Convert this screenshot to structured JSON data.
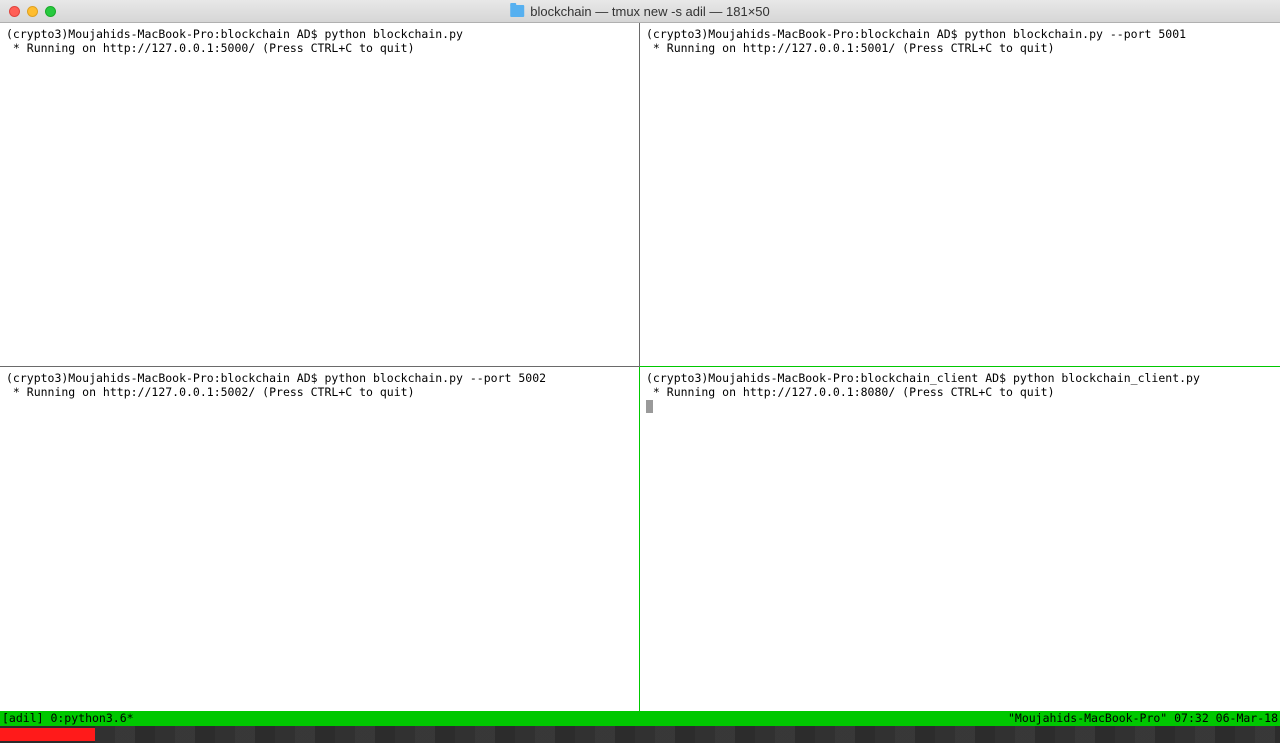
{
  "window": {
    "title": "blockchain — tmux new -s adil — 181×50"
  },
  "panes": {
    "tl": {
      "line1": "(crypto3)Moujahids-MacBook-Pro:blockchain AD$ python blockchain.py",
      "line2": " * Running on http://127.0.0.1:5000/ (Press CTRL+C to quit)"
    },
    "tr": {
      "line1": "(crypto3)Moujahids-MacBook-Pro:blockchain AD$ python blockchain.py --port 5001",
      "line2": " * Running on http://127.0.0.1:5001/ (Press CTRL+C to quit)"
    },
    "bl": {
      "line1": "(crypto3)Moujahids-MacBook-Pro:blockchain AD$ python blockchain.py --port 5002",
      "line2": " * Running on http://127.0.0.1:5002/ (Press CTRL+C to quit)"
    },
    "br": {
      "line1": "(crypto3)Moujahids-MacBook-Pro:blockchain_client AD$ python blockchain_client.py",
      "line2": " * Running on http://127.0.0.1:8080/ (Press CTRL+C to quit)"
    }
  },
  "status": {
    "left": "[adil] 0:python3.6*",
    "right": "\"Moujahids-MacBook-Pro\" 07:32 06-Mar-18"
  }
}
